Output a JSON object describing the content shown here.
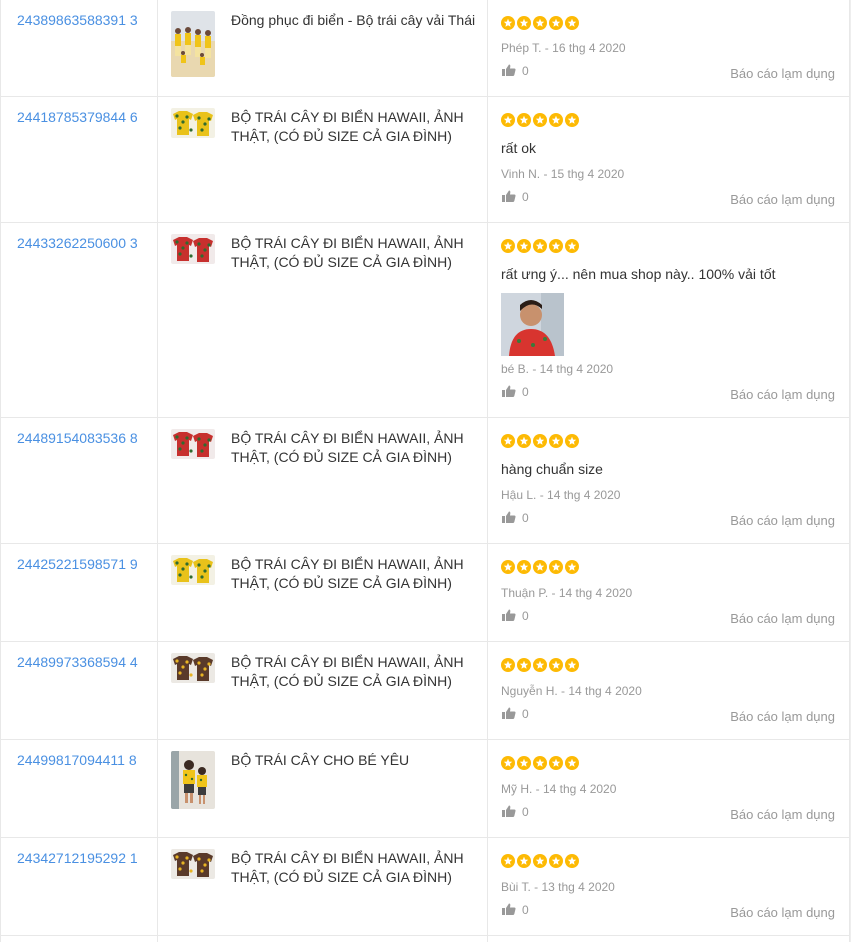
{
  "reviews": [
    {
      "order_id": "24389863588391 3",
      "product_name": "Đồng phục đi biển - Bộ trái cây vải Thái",
      "thumb_icon": "group-beach-photo-icon",
      "rating": 5,
      "comment": "",
      "has_photo": false,
      "meta": "Phép T. - 16 thg 4 2020",
      "likes": "0",
      "report_label": "Báo cáo lạm dụng"
    },
    {
      "order_id": "24418785379844 6",
      "product_name": "BỘ TRÁI CÂY ĐI BIỂN HAWAII, ẢNH THẬT, (CÓ ĐỦ SIZE CẢ GIA ĐÌNH)",
      "thumb_icon": "yellow-fruit-shirts-icon",
      "rating": 5,
      "comment": "rất ok",
      "has_photo": false,
      "meta": "Vinh N. - 15 thg 4 2020",
      "likes": "0",
      "report_label": "Báo cáo lạm dụng"
    },
    {
      "order_id": "24433262250600 3",
      "product_name": "BỘ TRÁI CÂY ĐI BIỂN HAWAII, ẢNH THẬT, (CÓ ĐỦ SIZE CẢ GIA ĐÌNH)",
      "thumb_icon": "red-fruit-shirts-icon",
      "rating": 5,
      "comment": "rất ưng ý... nên mua shop này.. 100% vải tốt",
      "has_photo": true,
      "meta": "bé B. - 14 thg 4 2020",
      "likes": "0",
      "report_label": "Báo cáo lạm dụng"
    },
    {
      "order_id": "24489154083536 8",
      "product_name": "BỘ TRÁI CÂY ĐI BIỂN HAWAII, ẢNH THẬT, (CÓ ĐỦ SIZE CẢ GIA ĐÌNH)",
      "thumb_icon": "red-fruit-shirts-icon",
      "rating": 5,
      "comment": "hàng chuẩn size",
      "has_photo": false,
      "meta": "Hậu L. - 14 thg 4 2020",
      "likes": "0",
      "report_label": "Báo cáo lạm dụng"
    },
    {
      "order_id": "24425221598571 9",
      "product_name": "BỘ TRÁI CÂY ĐI BIỂN HAWAII, ẢNH THẬT, (CÓ ĐỦ SIZE CẢ GIA ĐÌNH)",
      "thumb_icon": "yellow-fruit-shirts-icon",
      "rating": 5,
      "comment": "",
      "has_photo": false,
      "meta": "Thuận P. - 14 thg 4 2020",
      "likes": "0",
      "report_label": "Báo cáo lạm dụng"
    },
    {
      "order_id": "24489973368594 4",
      "product_name": "BỘ TRÁI CÂY ĐI BIỂN HAWAII, ẢNH THẬT, (CÓ ĐỦ SIZE CẢ GIA ĐÌNH)",
      "thumb_icon": "dark-fruit-shirts-icon",
      "rating": 5,
      "comment": "",
      "has_photo": false,
      "meta": "Nguyễn H. - 14 thg 4 2020",
      "likes": "0",
      "report_label": "Báo cáo lạm dụng"
    },
    {
      "order_id": "24499817094411 8",
      "product_name": "BỘ TRÁI CÂY CHO BÉ YÊU",
      "thumb_icon": "kids-fruit-outfit-icon",
      "rating": 5,
      "comment": "",
      "has_photo": false,
      "meta": "Mỹ H. - 14 thg 4 2020",
      "likes": "0",
      "report_label": "Báo cáo lạm dụng"
    },
    {
      "order_id": "24342712195292 1",
      "product_name": "BỘ TRÁI CÂY ĐI BIỂN HAWAII, ẢNH THẬT, (CÓ ĐỦ SIZE CẢ GIA ĐÌNH)",
      "thumb_icon": "dark-fruit-shirts-icon",
      "rating": 5,
      "comment": "",
      "has_photo": false,
      "meta": "Bùi T. - 13 thg 4 2020",
      "likes": "0",
      "report_label": "Báo cáo lạm dụng"
    }
  ],
  "colors": {
    "link": "#4a90e2",
    "star": "#fdba04",
    "muted": "#999999",
    "border": "#e8e8e8"
  }
}
